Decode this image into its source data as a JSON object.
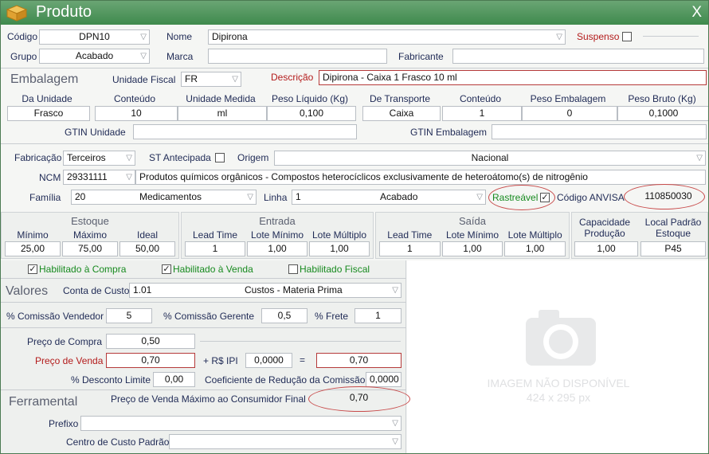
{
  "window": {
    "title": "Produto",
    "close": "X"
  },
  "row1": {
    "codigo_label": "Código",
    "codigo": "DPN10",
    "nome_label": "Nome",
    "nome": "Dipirona",
    "suspenso_label": "Suspenso"
  },
  "row2": {
    "grupo_label": "Grupo",
    "grupo": "Acabado",
    "marca_label": "Marca",
    "marca": "",
    "fabricante_label": "Fabricante",
    "fabricante": ""
  },
  "emb": {
    "section": "Embalagem",
    "unidade_fiscal_label": "Unidade Fiscal",
    "unidade_fiscal": "FR",
    "descricao_label": "Descrição",
    "descricao": "Dipirona - Caixa 1 Frasco 10 ml",
    "headers": [
      "Da Unidade",
      "Conteúdo",
      "Unidade Medida",
      "Peso Líquido (Kg)",
      "De Transporte",
      "Conteúdo",
      "Peso Embalagem",
      "Peso Bruto (Kg)"
    ],
    "values": [
      "Frasco",
      "10",
      "ml",
      "0,100",
      "Caixa",
      "1",
      "0",
      "0,1000"
    ],
    "gtin_unidade_label": "GTIN Unidade",
    "gtin_unidade": "",
    "gtin_embalagem_label": "GTIN Embalagem",
    "gtin_embalagem": ""
  },
  "fab": {
    "fabricacao_label": "Fabricação",
    "fabricacao": "Terceiros",
    "st_label": "ST Antecipada",
    "origem_label": "Origem",
    "origem": "Nacional",
    "ncm_label": "NCM",
    "ncm_code": "29331111",
    "ncm_desc": "Produtos químicos orgânicos - Compostos heterocíclicos exclusivamente de heteroátomo(s) de nitrogênio",
    "familia_label": "Família",
    "familia_code": "20",
    "familia": "Medicamentos",
    "linha_label": "Linha",
    "linha_code": "1",
    "linha": "Acabado",
    "rastreavel_label": "Rastreável",
    "anvisa_label": "Código ANVISA",
    "anvisa": "110850030"
  },
  "estoque": {
    "title": "Estoque",
    "labels": [
      "Mínimo",
      "Máximo",
      "Ideal"
    ],
    "values": [
      "25,00",
      "75,00",
      "50,00"
    ]
  },
  "entrada": {
    "title": "Entrada",
    "labels": [
      "Lead Time",
      "Lote Mínimo",
      "Lote Múltiplo"
    ],
    "values": [
      "1",
      "1,00",
      "1,00"
    ]
  },
  "saida": {
    "title": "Saída",
    "labels": [
      "Lead Time",
      "Lote Mínimo",
      "Lote Múltiplo"
    ],
    "values": [
      "1",
      "1,00",
      "1,00"
    ]
  },
  "cap": {
    "label1": "Capacidade",
    "label2": "Produção",
    "value": "1,00",
    "local1": "Local Padrão",
    "local2": "Estoque",
    "local": "P45"
  },
  "hab": {
    "compra": "Habilitado à Compra",
    "venda": "Habilitado à Venda",
    "fiscal": "Habilitado Fiscal"
  },
  "valores": {
    "section": "Valores",
    "conta_label": "Conta de Custo",
    "conta_code": "1.01",
    "conta": "Custos - Materia Prima",
    "com_vend_label": "% Comissão Vendedor",
    "com_vend": "5",
    "com_ger_label": "% Comissão Gerente",
    "com_ger": "0,5",
    "frete_label": "% Frete",
    "frete": "1",
    "compra_label": "Preço de Compra",
    "compra": "0,50",
    "venda_label": "Preço de Venda",
    "venda": "0,70",
    "ipi_label": "+ R$ IPI",
    "ipi": "0,0000",
    "eq": "=",
    "total": "0,70",
    "desc_label": "% Desconto Limite",
    "desc": "0,00",
    "coef_label": "Coeficiente de Redução da Comissão",
    "coef": "0,0000"
  },
  "ferr": {
    "section": "Ferramental",
    "pmc_label": "Preço de Venda Máximo ao Consumidor Final",
    "pmc": "0,70",
    "prefixo_label": "Prefixo",
    "centro_label": "Centro de Custo Padrão"
  },
  "image": {
    "line1": "IMAGEM NÃO DISPONÍVEL",
    "line2": "424 x 295 px"
  }
}
